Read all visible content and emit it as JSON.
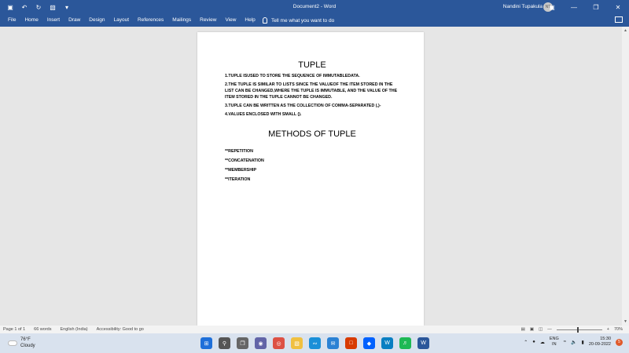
{
  "window": {
    "title": "Document2 - Word",
    "user_name": "Nandini Tupakula",
    "avatar_initials": "NT"
  },
  "quick_access": {
    "save_icon": "save-icon",
    "undo_icon": "undo-icon",
    "redo_icon": "redo-icon",
    "new_icon": "new-document-icon"
  },
  "ribbon": {
    "tabs": [
      "File",
      "Home",
      "Insert",
      "Draw",
      "Design",
      "Layout",
      "References",
      "Mailings",
      "Review",
      "View",
      "Help"
    ],
    "tell_me": "Tell me what you want to do"
  },
  "document": {
    "title": "TUPLE",
    "paragraphs": [
      "1.TUPLE ISUSED TO STORE THE SEQUENCE OF IMMUTABLEDATA.",
      "2.THE TUPLE IS SIMILAR TO LISTS SINCE THE VALUEOF THE ITEM STORED IN THE LIST CAN BE CHANGED,WHERE THE TUPLE IS IMMUTABLE, AND THE VALUE OF THE ITEM STORED IN THE TUPLE CANNOT BE CHANGED.",
      "3.TUPLE CAN BE WRITTEN AS THE COLLECTION OF COMMA-SEPARATED (,)-",
      "4.VALUES ENCLOSED WITH SMALL ()."
    ],
    "subtitle": "METHODS OF TUPLE",
    "methods": [
      "**REPETITION",
      "**CONCATENATION",
      "**MEMBERSHIP",
      "**ITERATION"
    ]
  },
  "status_bar": {
    "page": "Page 1 of 1",
    "words": "66 words",
    "language": "English (India)",
    "accessibility": "Accessibility: Good to go",
    "zoom": "70%"
  },
  "taskbar": {
    "temperature": "76°F",
    "weather": "Cloudy",
    "lang_top": "ENG",
    "lang_bottom": "IN",
    "time": "15:30",
    "date": "20-09-2022",
    "notifications": "5"
  }
}
